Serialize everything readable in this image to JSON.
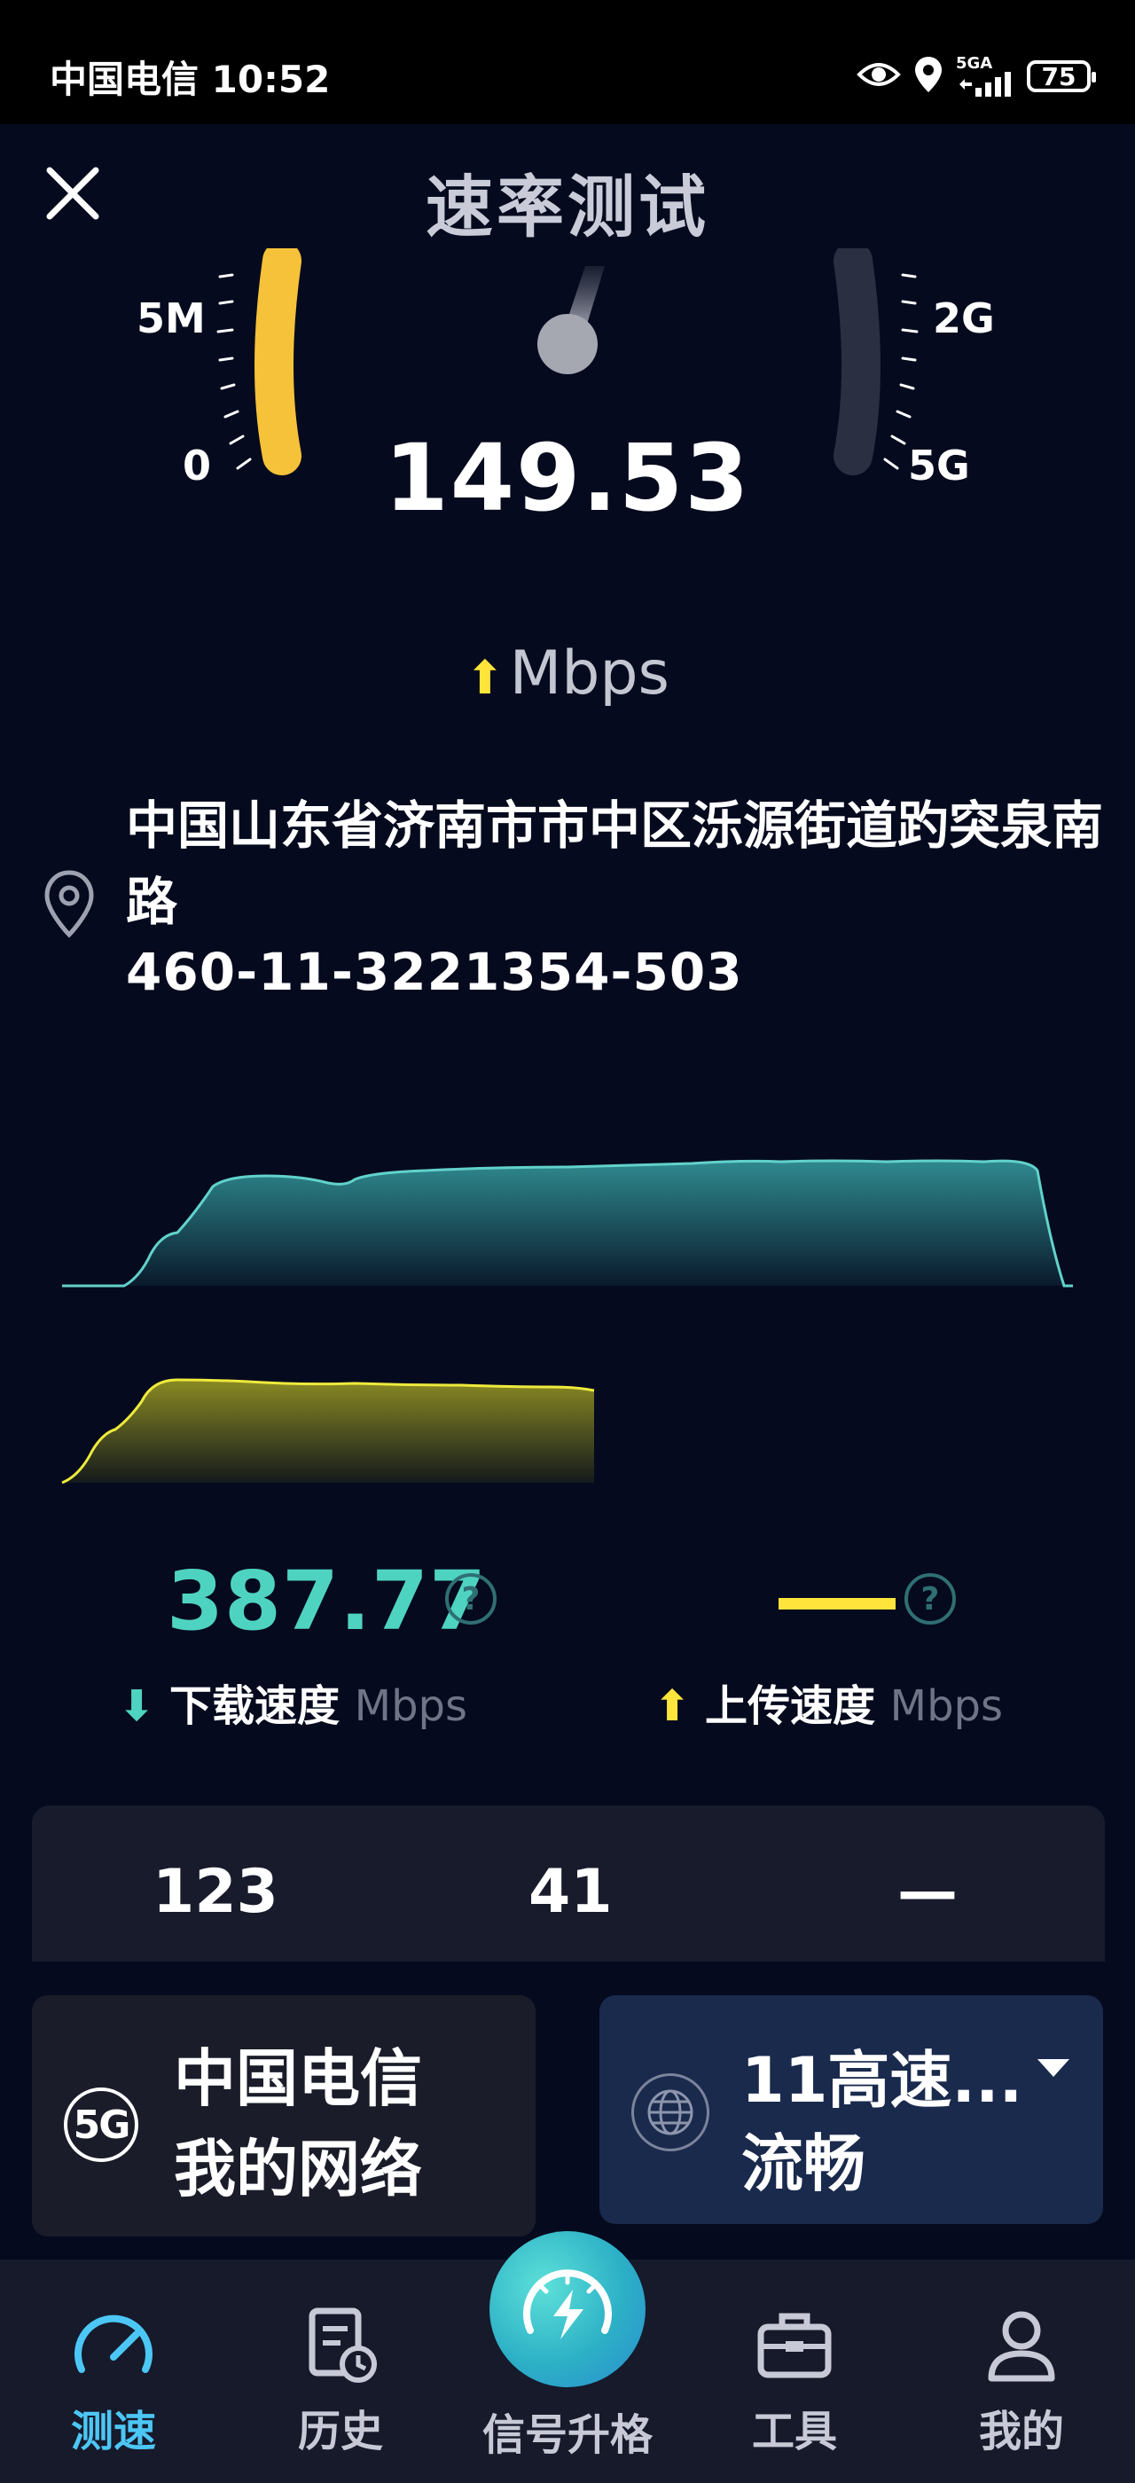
{
  "status_bar": {
    "carrier_time": "中国电信 10:52",
    "network_type": "5GA",
    "battery": "75"
  },
  "header": {
    "title": "速率测试"
  },
  "gauge": {
    "left_labels": [
      "5M",
      "0"
    ],
    "right_labels": [
      "2G",
      "5G"
    ],
    "current_speed": "149.53",
    "unit": "Mbps",
    "accent_color": "#f6c23a"
  },
  "location": {
    "address": "中国山东省济南市市中区泺源街道趵突泉南路",
    "cell_id": "460-11-3221354-503"
  },
  "results": {
    "download_value": "387.77",
    "download_label": "下载速度",
    "download_unit": "Mbps",
    "upload_label": "上传速度",
    "upload_unit": "Mbps",
    "download_color": "#4fd3c1",
    "upload_color": "#ffe53b"
  },
  "stats": {
    "values": [
      "123",
      "41",
      "—"
    ]
  },
  "network": {
    "badge": "5G",
    "operator": "中国电信",
    "name": "我的网络"
  },
  "wifi": {
    "name": "11高速...",
    "status": "流畅"
  },
  "bottom_nav": {
    "items": [
      {
        "label": "测速",
        "icon": "speedometer-icon"
      },
      {
        "label": "历史",
        "icon": "history-icon"
      },
      {
        "label": "信号升格",
        "icon": "signal-boost-icon"
      },
      {
        "label": "工具",
        "icon": "toolbox-icon"
      },
      {
        "label": "我的",
        "icon": "profile-icon"
      }
    ]
  }
}
